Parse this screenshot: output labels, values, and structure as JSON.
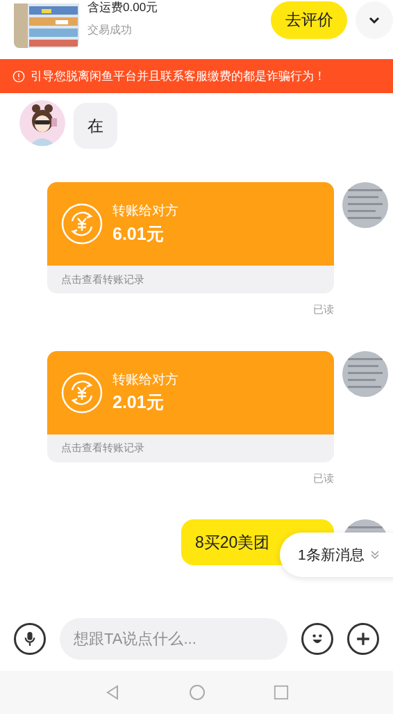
{
  "order": {
    "shipping": "含运费0.00元",
    "status": "交易成功",
    "review_button": "去评价"
  },
  "warning": {
    "text": "引导您脱离闲鱼平台并且联系客服缴费的都是诈骗行为！"
  },
  "messages": [
    {
      "kind": "text",
      "outgoing": false,
      "text": "在"
    },
    {
      "kind": "transfer",
      "outgoing": true,
      "title": "转账给对方",
      "amount": "6.01元",
      "link": "点击查看转账记录",
      "receipt": "已读"
    },
    {
      "kind": "transfer",
      "outgoing": true,
      "title": "转账给对方",
      "amount": "2.01元",
      "link": "点击查看转账记录",
      "receipt": "已读"
    },
    {
      "kind": "text",
      "outgoing": true,
      "text": "8买20美团"
    }
  ],
  "new_messages": {
    "label": "1条新消息"
  },
  "composer": {
    "placeholder": "想跟TA说点什么..."
  }
}
